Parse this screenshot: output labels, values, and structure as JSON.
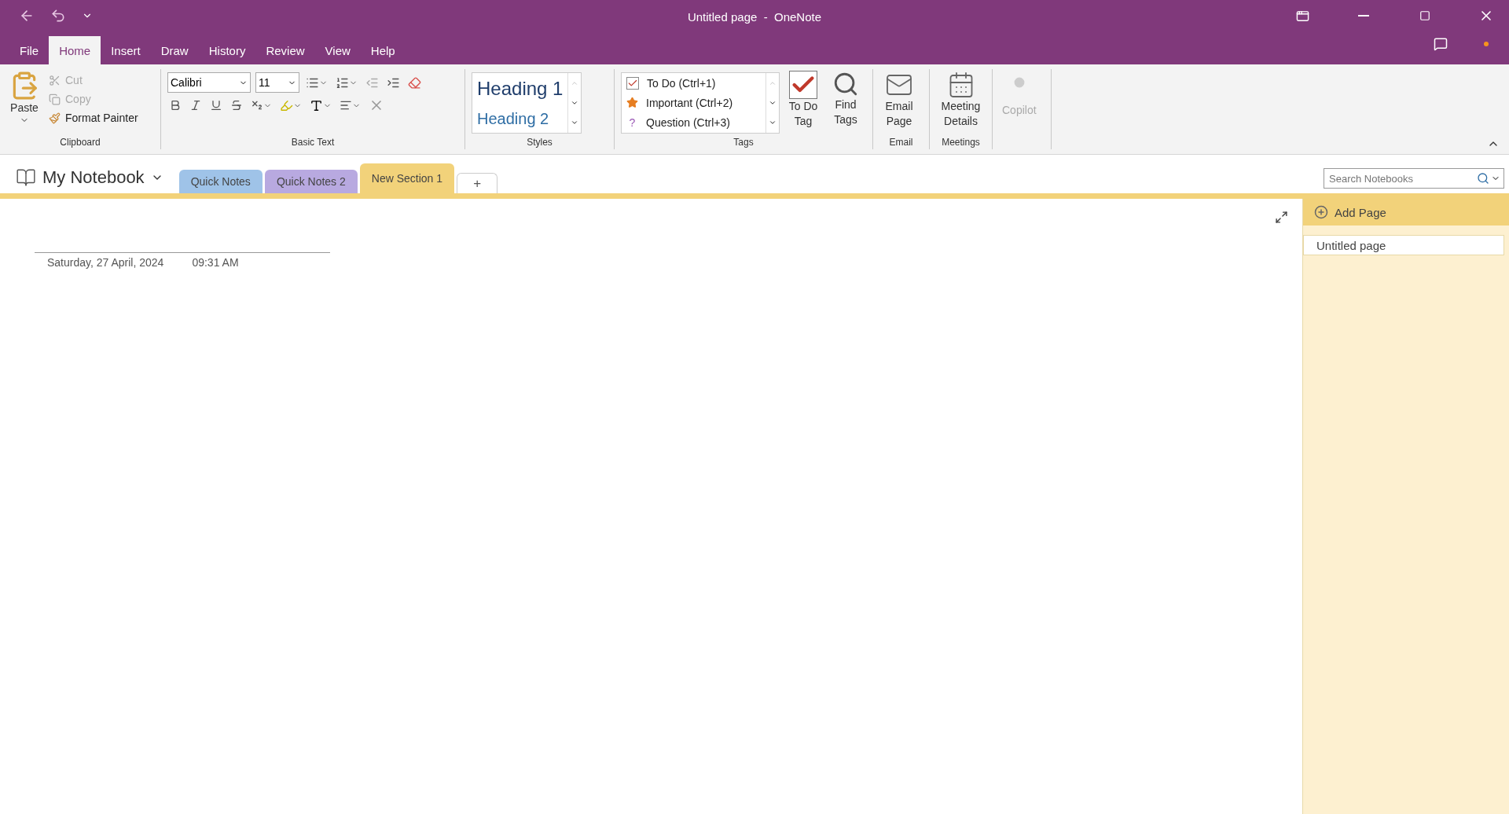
{
  "window": {
    "title": "Untitled page  -  OneNote"
  },
  "menu_tabs": [
    {
      "label": "File",
      "selected": false
    },
    {
      "label": "Home",
      "selected": true
    },
    {
      "label": "Insert",
      "selected": false
    },
    {
      "label": "Draw",
      "selected": false
    },
    {
      "label": "History",
      "selected": false
    },
    {
      "label": "Review",
      "selected": false
    },
    {
      "label": "View",
      "selected": false
    },
    {
      "label": "Help",
      "selected": false
    }
  ],
  "ribbon": {
    "clipboard": {
      "label": "Clipboard",
      "paste": "Paste",
      "items": [
        {
          "kind": "cut",
          "label": "Cut",
          "disabled": true
        },
        {
          "kind": "copy",
          "label": "Copy",
          "disabled": true
        },
        {
          "kind": "painter",
          "label": "Format Painter",
          "disabled": false
        }
      ]
    },
    "basic_text": {
      "label": "Basic Text",
      "font": "Calibri",
      "size": "11"
    },
    "styles": {
      "label": "Styles",
      "items": [
        "Heading 1",
        "Heading 2"
      ]
    },
    "tags": {
      "label": "Tags",
      "items": [
        {
          "kind": "todo",
          "label": "To Do (Ctrl+1)"
        },
        {
          "kind": "important",
          "label": "Important (Ctrl+2)"
        },
        {
          "kind": "question",
          "symbol": "?",
          "label": "Question (Ctrl+3)"
        }
      ],
      "buttons": [
        {
          "kind": "todo",
          "label": "To Do Tag"
        },
        {
          "kind": "find",
          "label": "Find Tags"
        }
      ]
    },
    "email": {
      "label": "Email",
      "button": "Email Page"
    },
    "meetings": {
      "label": "Meetings",
      "button": "Meeting Details"
    },
    "copilot": {
      "button": "Copilot",
      "disabled": true
    }
  },
  "notebook": {
    "name": "My Notebook"
  },
  "sections": [
    {
      "label": "Quick Notes",
      "color": "#9fc3e8",
      "selected": false
    },
    {
      "label": "Quick Notes 2",
      "color": "#b8a9e0",
      "selected": false
    },
    {
      "label": "New Section 1",
      "color": "#f2d27a",
      "selected": true
    }
  ],
  "add_section": "+",
  "search": {
    "placeholder": "Search Notebooks"
  },
  "page": {
    "date": "Saturday, 27 April, 2024",
    "time": "09:31 AM"
  },
  "page_list": {
    "add": "Add Page",
    "pages": [
      {
        "title": "Untitled page",
        "selected": true
      }
    ]
  }
}
